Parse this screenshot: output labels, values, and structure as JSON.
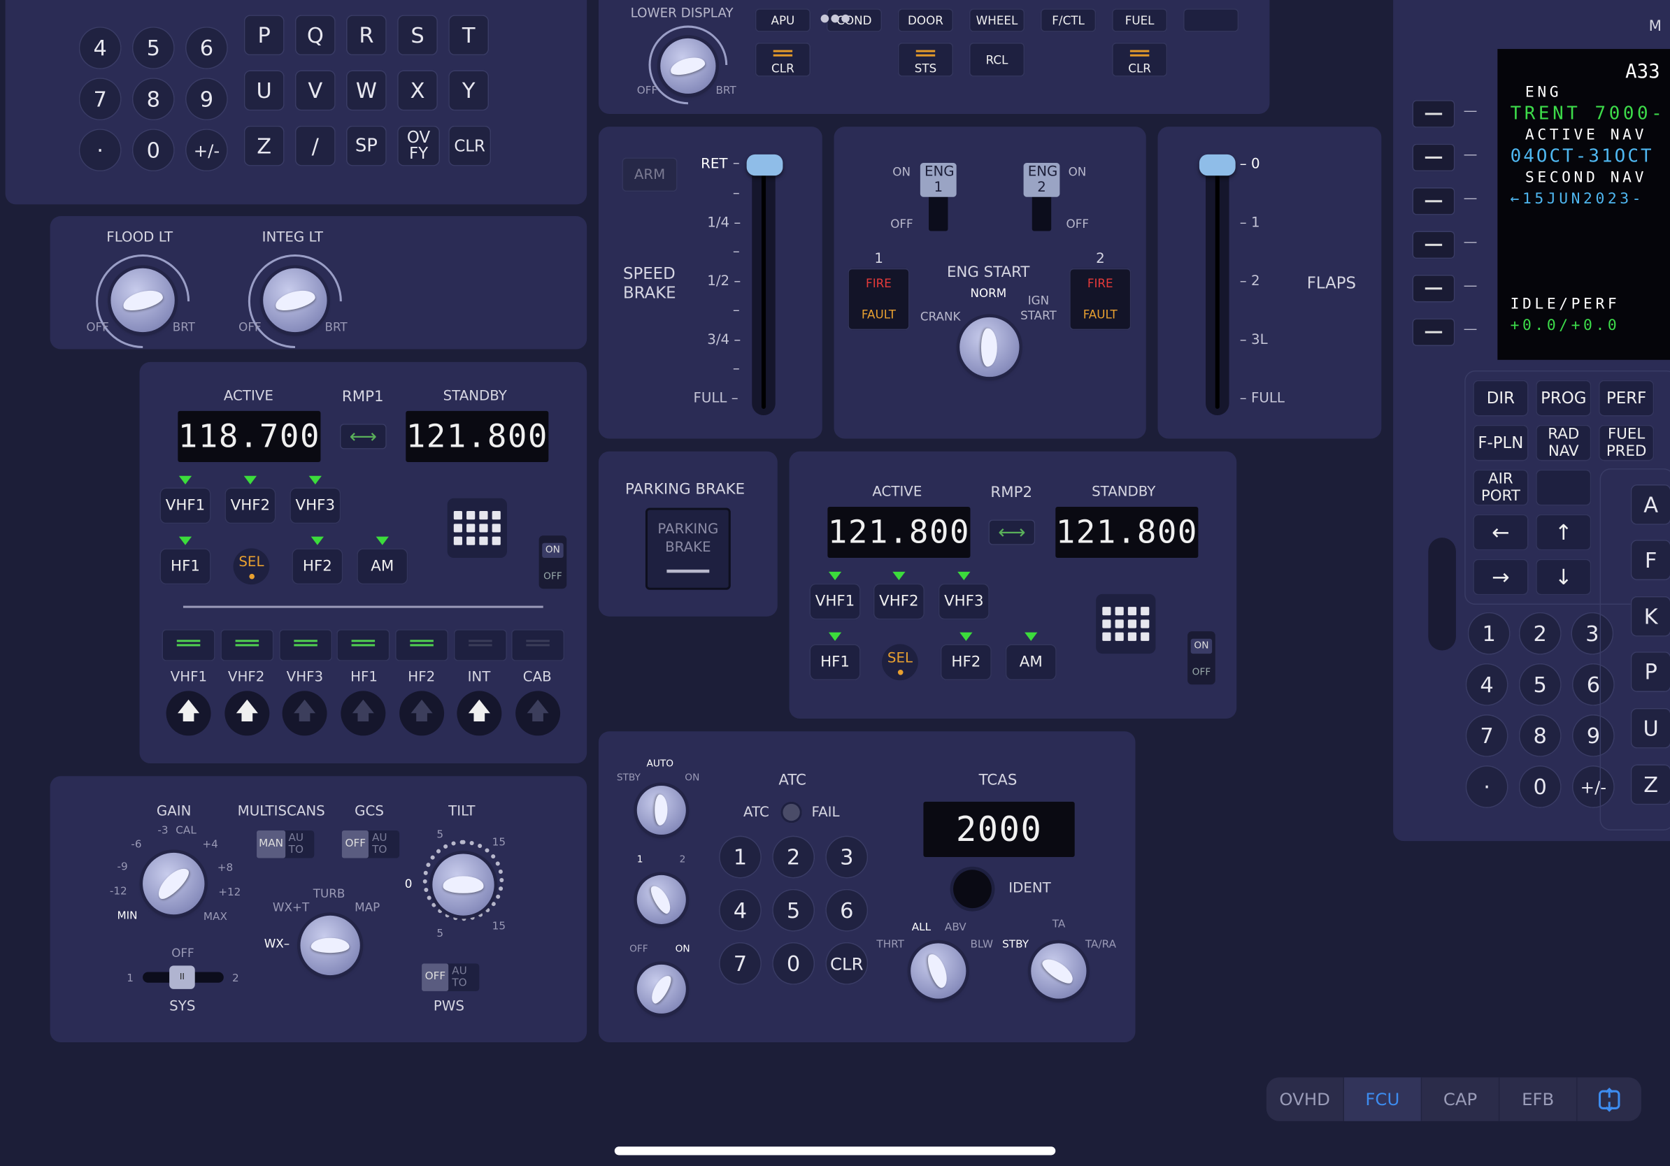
{
  "mcdu_left": {
    "num_keys": [
      "4",
      "5",
      "6",
      "7",
      "8",
      "9",
      "·",
      "0",
      "+/-"
    ],
    "alpha_keys": [
      "P",
      "Q",
      "R",
      "S",
      "T",
      "U",
      "V",
      "W",
      "X",
      "Y",
      "Z",
      "/",
      "SP",
      "OV FY",
      "CLR"
    ]
  },
  "lights": {
    "flood": "FLOOD LT",
    "integ": "INTEG LT",
    "off": "OFF",
    "brt": "BRT"
  },
  "ecam": {
    "top_label": "LOWER DISPLAY",
    "pages": [
      "APU",
      "COND",
      "DOOR",
      "WHEEL",
      "F/CTL",
      "FUEL"
    ],
    "clr": "CLR",
    "sts": "STS",
    "rcl": "RCL",
    "off": "OFF",
    "brt": "BRT"
  },
  "speed_brake": {
    "arm": "ARM",
    "title": "SPEED BRAKE",
    "ticks": [
      "RET",
      "1/4",
      "1/2",
      "3/4",
      "FULL"
    ]
  },
  "eng": {
    "on": "ON",
    "off": "OFF",
    "eng1": "ENG 1",
    "eng2": "ENG 2",
    "title": "ENG START",
    "norm": "NORM",
    "crank": "CRANK",
    "ign": "IGN START",
    "fire": "FIRE",
    "fault": "FAULT",
    "n1": "1",
    "n2": "2"
  },
  "flaps": {
    "title": "FLAPS",
    "ticks": [
      "0",
      "1",
      "2",
      "3L",
      "FULL"
    ]
  },
  "mcdu_right": {
    "title": "A33",
    "lines": [
      {
        "label": "ENG",
        "value": "TRENT 7000-"
      },
      {
        "label": "ACTIVE NAV",
        "value": "04OCT-31OCT"
      },
      {
        "label": "SECOND NAV",
        "value": "←15JUN2023-"
      },
      {
        "label": "IDLE/PERF",
        "value": "+0.0/+0.0"
      }
    ],
    "fn_keys": [
      "DIR",
      "PROG",
      "PERF",
      "F-PLN",
      "RAD NAV",
      "FUEL PRED",
      "AIR PORT",
      ""
    ],
    "arrows": [
      "←",
      "↑",
      "→",
      "↓"
    ],
    "num_keys": [
      "1",
      "2",
      "3",
      "4",
      "5",
      "6",
      "7",
      "8",
      "9",
      "·",
      "0",
      "+/-"
    ],
    "alpha": [
      "A",
      "F",
      "K",
      "P",
      "U",
      "Z"
    ],
    "partial_label": "M"
  },
  "rmp1": {
    "title": "RMP1",
    "active_label": "ACTIVE",
    "standby_label": "STANDBY",
    "active": "118.700",
    "standby": "121.800",
    "keys": [
      "VHF1",
      "VHF2",
      "VHF3",
      "HF1",
      "SEL",
      "HF2",
      "AM"
    ],
    "on": "ON",
    "off": "OFF"
  },
  "acp": {
    "labels": [
      "VHF1",
      "VHF2",
      "VHF3",
      "HF1",
      "HF2",
      "INT",
      "CAB"
    ]
  },
  "parking_brake": {
    "title": "PARKING BRAKE",
    "button": "PARKING BRAKE"
  },
  "rmp2": {
    "title": "RMP2",
    "active_label": "ACTIVE",
    "standby_label": "STANDBY",
    "active": "121.800",
    "standby": "121.800",
    "keys": [
      "VHF1",
      "VHF2",
      "VHF3",
      "HF1",
      "SEL",
      "HF2",
      "AM"
    ],
    "on": "ON",
    "off": "OFF"
  },
  "wx": {
    "gain": "GAIN",
    "gain_ticks": [
      "-3",
      "CAL",
      "+4",
      "+8",
      "+12",
      "MAX",
      "MIN",
      "-12",
      "-9",
      "-6"
    ],
    "multiscans": "MULTISCANS",
    "man": "MAN",
    "auto": "AU TO",
    "gcs": "GCS",
    "off": "OFF",
    "tilt": "TILT",
    "tilt_ticks": [
      "5",
      "15",
      "0",
      "5",
      "15"
    ],
    "mode_ticks": [
      "TURB",
      "WX+T",
      "MAP",
      "WX"
    ],
    "sys": "SYS",
    "sys_off": "OFF",
    "sys1": "1",
    "sys2": "2",
    "pws": "PWS"
  },
  "atc": {
    "title": "ATC",
    "atc": "ATC",
    "fail": "FAIL",
    "keys": [
      "1",
      "2",
      "3",
      "4",
      "5",
      "6",
      "7",
      "0",
      "CLR"
    ],
    "knob1": [
      "STBY",
      "AUTO",
      "ON"
    ],
    "knob2": [
      "1",
      "2"
    ],
    "knob3": [
      "OFF",
      "ON"
    ]
  },
  "tcas": {
    "title": "TCAS",
    "code": "2000",
    "ident": "IDENT",
    "left_ticks": [
      "THRT",
      "ALL",
      "ABV",
      "BLW"
    ],
    "right_ticks": [
      "STBY",
      "TA",
      "TA/RA"
    ]
  },
  "nav": {
    "tabs": [
      "OVHD",
      "FCU",
      "CAP",
      "EFB"
    ],
    "active": "FCU"
  }
}
